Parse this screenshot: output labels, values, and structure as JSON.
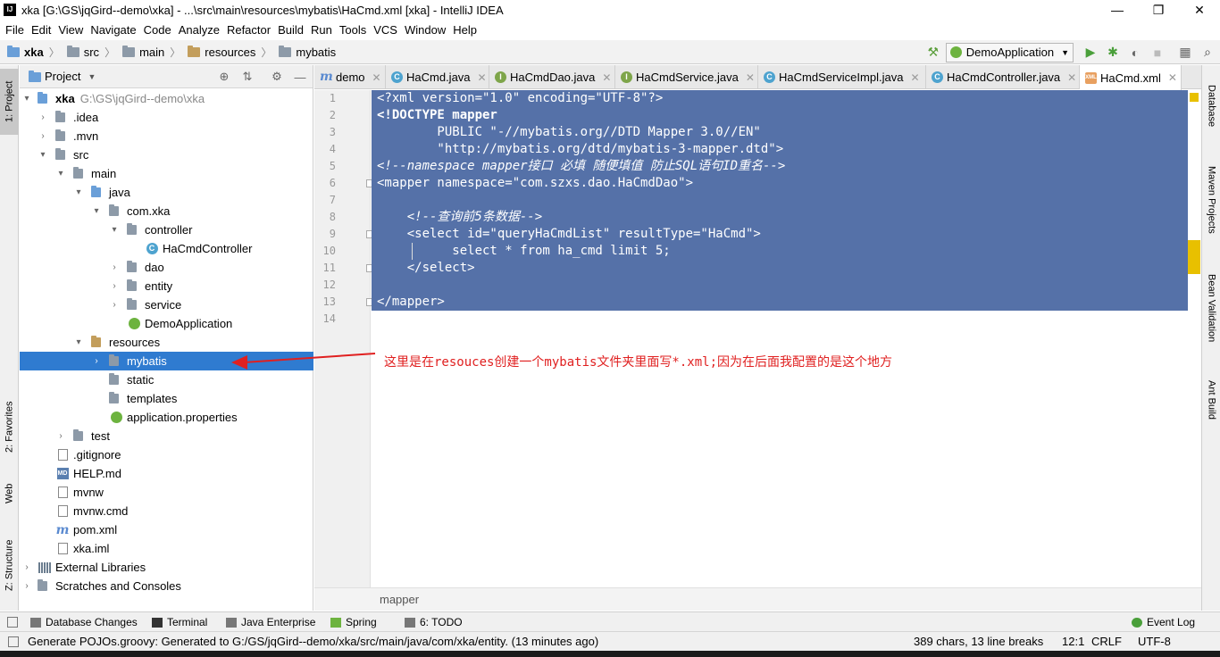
{
  "window": {
    "title": "xka [G:\\GS\\jqGird--demo\\xka] - ...\\src\\main\\resources\\mybatis\\HaCmd.xml [xka] - IntelliJ IDEA",
    "app_icon_text": "IJ",
    "minimize": "—",
    "restore": "❐",
    "close": "✕"
  },
  "menu": [
    "File",
    "Edit",
    "View",
    "Navigate",
    "Code",
    "Analyze",
    "Refactor",
    "Build",
    "Run",
    "Tools",
    "VCS",
    "Window",
    "Help"
  ],
  "navbar": {
    "crumbs": [
      "xka",
      "src",
      "main",
      "resources",
      "mybatis"
    ],
    "run_config": "DemoApplication"
  },
  "left_stripe": {
    "project": "1: Project",
    "favorites": "2: Favorites",
    "web": "Web",
    "structure": "Z: Structure"
  },
  "right_stripe": {
    "database": "Database",
    "maven": "Maven Projects",
    "bean": "Bean Validation",
    "ant": "Ant Build"
  },
  "project_panel": {
    "title": "Project",
    "tree": [
      {
        "label": "xka",
        "path": "G:\\GS\\jqGird--demo\\xka"
      },
      {
        "label": ".idea"
      },
      {
        "label": ".mvn"
      },
      {
        "label": "src"
      },
      {
        "label": "main"
      },
      {
        "label": "java"
      },
      {
        "label": "com.xka"
      },
      {
        "label": "controller"
      },
      {
        "label": "HaCmdController"
      },
      {
        "label": "dao"
      },
      {
        "label": "entity"
      },
      {
        "label": "service"
      },
      {
        "label": "DemoApplication"
      },
      {
        "label": "resources"
      },
      {
        "label": "mybatis"
      },
      {
        "label": "static"
      },
      {
        "label": "templates"
      },
      {
        "label": "application.properties"
      },
      {
        "label": "test"
      },
      {
        "label": ".gitignore"
      },
      {
        "label": "HELP.md"
      },
      {
        "label": "mvnw"
      },
      {
        "label": "mvnw.cmd"
      },
      {
        "label": "pom.xml"
      },
      {
        "label": "xka.iml"
      },
      {
        "label": "External Libraries"
      },
      {
        "label": "Scratches and Consoles"
      }
    ]
  },
  "editor_tabs": [
    {
      "label": "demo",
      "icon": "m"
    },
    {
      "label": "HaCmd.java",
      "icon": "C"
    },
    {
      "label": "HaCmdDao.java",
      "icon": "I"
    },
    {
      "label": "HaCmdService.java",
      "icon": "I"
    },
    {
      "label": "HaCmdServiceImpl.java",
      "icon": "C"
    },
    {
      "label": "HaCmdController.java",
      "icon": "C"
    },
    {
      "label": "HaCmd.xml",
      "icon": "xml"
    }
  ],
  "editor": {
    "line_numbers": [
      "1",
      "2",
      "3",
      "4",
      "5",
      "6",
      "7",
      "8",
      "9",
      "10",
      "11",
      "12",
      "13",
      "14"
    ],
    "lines": [
      "<?xml version=\"1.0\" encoding=\"UTF-8\"?>",
      "<!DOCTYPE mapper",
      "        PUBLIC \"-//mybatis.org//DTD Mapper 3.0//EN\"",
      "        \"http://mybatis.org/dtd/mybatis-3-mapper.dtd\">",
      "<!--namespace mapper接口 必填 随便填值 防止SQL语句ID重名-->",
      "<mapper namespace=\"com.szxs.dao.HaCmdDao\">",
      "",
      "    <!--查询前5条数据-->",
      "    <select id=\"queryHaCmdList\" resultType=\"HaCmd\">",
      "          select * from ha_cmd limit 5;",
      "    </select>",
      "",
      "</mapper>",
      ""
    ],
    "breadcrumb": "mapper"
  },
  "annotation": {
    "text": "这里是在resouces创建一个mybatis文件夹里面写*.xml;因为在后面我配置的是这个地方",
    "color": "#e02020"
  },
  "bottom_tools": [
    "Database Changes",
    "Terminal",
    "Java Enterprise",
    "Spring",
    "6: TODO",
    "Event Log"
  ],
  "status": {
    "message": "Generate POJOs.groovy: Generated to G:/GS/jqGird--demo/xka/src/main/java/com/xka/entity. (13 minutes ago)",
    "chars": "389 chars, 13 line breaks",
    "position": "12:1",
    "line_sep": "CRLF",
    "encoding": "UTF-8"
  },
  "colors": {
    "selection": "#5571a8",
    "tree_selected": "#2f7bd0"
  }
}
